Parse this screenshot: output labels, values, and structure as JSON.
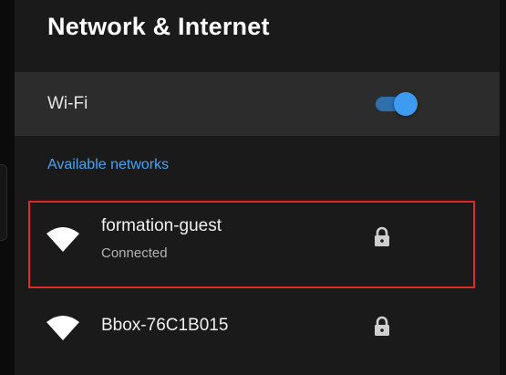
{
  "page": {
    "title": "Network & Internet"
  },
  "wifi": {
    "label": "Wi-Fi",
    "enabled": true
  },
  "available": {
    "header": "Available networks",
    "networks": [
      {
        "name": "formation-guest",
        "status": "Connected",
        "secured": true,
        "selected": true,
        "icon": "wifi-icon"
      },
      {
        "name": "Bbox-76C1B015",
        "status": "",
        "secured": true,
        "selected": false,
        "icon": "wifi-icon"
      }
    ]
  },
  "colors": {
    "accent": "#4aa3f0",
    "toggle_on": "#3d9bf2",
    "selection_outline": "#e02a2a"
  }
}
